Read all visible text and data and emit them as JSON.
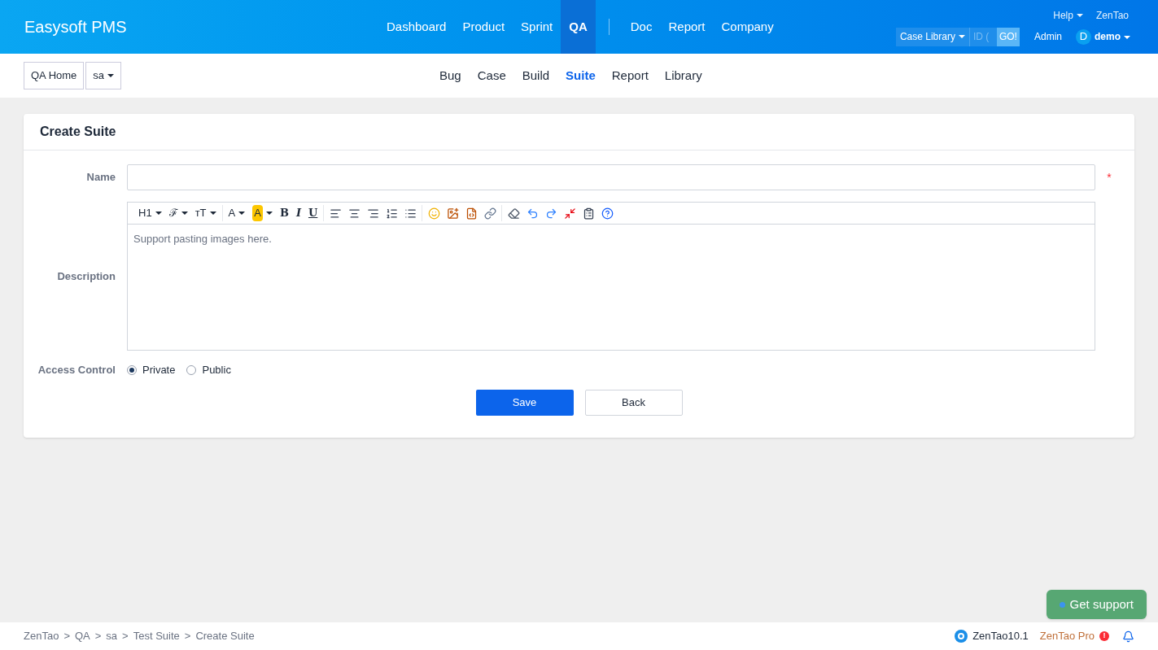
{
  "header": {
    "brand": "Easysoft PMS",
    "nav": [
      {
        "label": "Dashboard",
        "selected": false
      },
      {
        "label": "Product",
        "selected": false
      },
      {
        "label": "Sprint",
        "selected": false
      },
      {
        "label": "QA",
        "selected": true
      }
    ],
    "nav_after": [
      {
        "label": "Doc",
        "selected": false
      },
      {
        "label": "Report",
        "selected": false
      },
      {
        "label": "Company",
        "selected": false
      }
    ],
    "help": "Help",
    "zentao": "ZenTao",
    "search_scope": "Case Library",
    "search_placeholder": "ID (",
    "go": "GO!",
    "admin": "Admin",
    "avatar": "D",
    "user": "demo"
  },
  "subnav": {
    "breadcrumbs": [
      {
        "label": "QA Home",
        "caret": false
      },
      {
        "label": "sa",
        "caret": true
      }
    ],
    "tabs": [
      {
        "label": "Bug",
        "selected": false
      },
      {
        "label": "Case",
        "selected": false
      },
      {
        "label": "Build",
        "selected": false
      },
      {
        "label": "Suite",
        "selected": true
      },
      {
        "label": "Report",
        "selected": false
      },
      {
        "label": "Library",
        "selected": false
      }
    ]
  },
  "form": {
    "title": "Create Suite",
    "name_label": "Name",
    "required_mark": "*",
    "description_label": "Description",
    "toolbar": [
      [
        {
          "kind": "text",
          "label": "H1",
          "caret": true
        },
        {
          "kind": "text",
          "label": "ℱ",
          "caret": true
        },
        {
          "kind": "text",
          "label": "ᴛT",
          "caret": true
        }
      ],
      [
        {
          "kind": "fontcolor",
          "label": "A",
          "caret": true
        },
        {
          "kind": "highlight",
          "label": "A",
          "caret": true
        },
        {
          "kind": "bold",
          "label": "B",
          "caret": false
        },
        {
          "kind": "italic",
          "label": "I",
          "caret": false
        },
        {
          "kind": "underline",
          "label": "U",
          "caret": false
        }
      ],
      [
        {
          "kind": "align-left"
        },
        {
          "kind": "align-center"
        },
        {
          "kind": "align-right"
        },
        {
          "kind": "ordered-list"
        },
        {
          "kind": "bullet-list"
        }
      ],
      [
        {
          "kind": "emoji"
        },
        {
          "kind": "image"
        },
        {
          "kind": "code"
        },
        {
          "kind": "link"
        }
      ],
      [
        {
          "kind": "eraser"
        },
        {
          "kind": "undo"
        },
        {
          "kind": "redo"
        },
        {
          "kind": "fullscreen"
        },
        {
          "kind": "paste"
        },
        {
          "kind": "help"
        }
      ]
    ],
    "editor_placeholder": "Support pasting images here.",
    "access_label": "Access Control",
    "access_options": [
      {
        "label": "Private",
        "selected": true
      },
      {
        "label": "Public",
        "selected": false
      }
    ],
    "save": "Save",
    "back": "Back"
  },
  "footer": {
    "breadcrumbs": [
      "ZenTao",
      "QA",
      "sa",
      "Test Suite",
      "Create Suite"
    ],
    "separator": ">",
    "version": "ZenTao10.1",
    "pro": "ZenTao Pro",
    "pro_badge": "!"
  },
  "support": "Get support"
}
